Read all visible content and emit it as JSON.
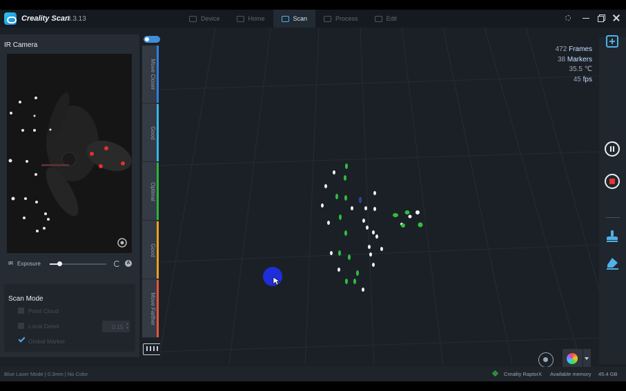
{
  "app": {
    "title": "Creality Scan",
    "version": "3.3.13"
  },
  "tabs": [
    {
      "label": "Device",
      "active": false
    },
    {
      "label": "Home",
      "active": false
    },
    {
      "label": "Scan",
      "active": true
    },
    {
      "label": "Process",
      "active": false
    },
    {
      "label": "Edit",
      "active": false
    }
  ],
  "left_panel": {
    "title": "IR Camera",
    "exposure": {
      "ir_label": "IR",
      "label": "Exposure",
      "level": 0.17,
      "auto_label": "A"
    }
  },
  "scan_mode": {
    "title": "Scan Mode",
    "options": [
      {
        "label": "Point Cloud",
        "checked": false
      },
      {
        "label": "Local Detail",
        "checked": false,
        "value": "0.15"
      },
      {
        "label": "Global Marker",
        "checked": true
      }
    ]
  },
  "distance": {
    "segments": [
      {
        "label": "Move Closer",
        "color": "#2f7fe0"
      },
      {
        "label": "Good",
        "color": "#34b8e8"
      },
      {
        "label": "Optimal",
        "color": "#2db33a"
      },
      {
        "label": "Good",
        "color": "#f0a020"
      },
      {
        "label": "Move Farther",
        "color": "#e8553a"
      }
    ],
    "current": "Optimal"
  },
  "stats": {
    "frames_value": "472",
    "frames_label": "Frames",
    "markers_value": "38",
    "markers_label": "Markers",
    "temp_value": "35.5",
    "temp_unit": "℃",
    "fps_value": "45",
    "fps_label": "fps"
  },
  "right_toolbar": [
    "add-icon",
    "pause-icon",
    "stop-icon",
    "brush-icon",
    "eraser-icon"
  ],
  "status": {
    "mode": "Blue Laser Mode | 0.3mm | No Color",
    "device": "Creality RaptorX",
    "memory_label": "Available memory",
    "memory_value": "45.4 GB"
  },
  "colors": {
    "accent": "#4fb2e8",
    "background": "#1b2027",
    "stop": "#e8342f",
    "cursor": "#1e2ed8"
  }
}
